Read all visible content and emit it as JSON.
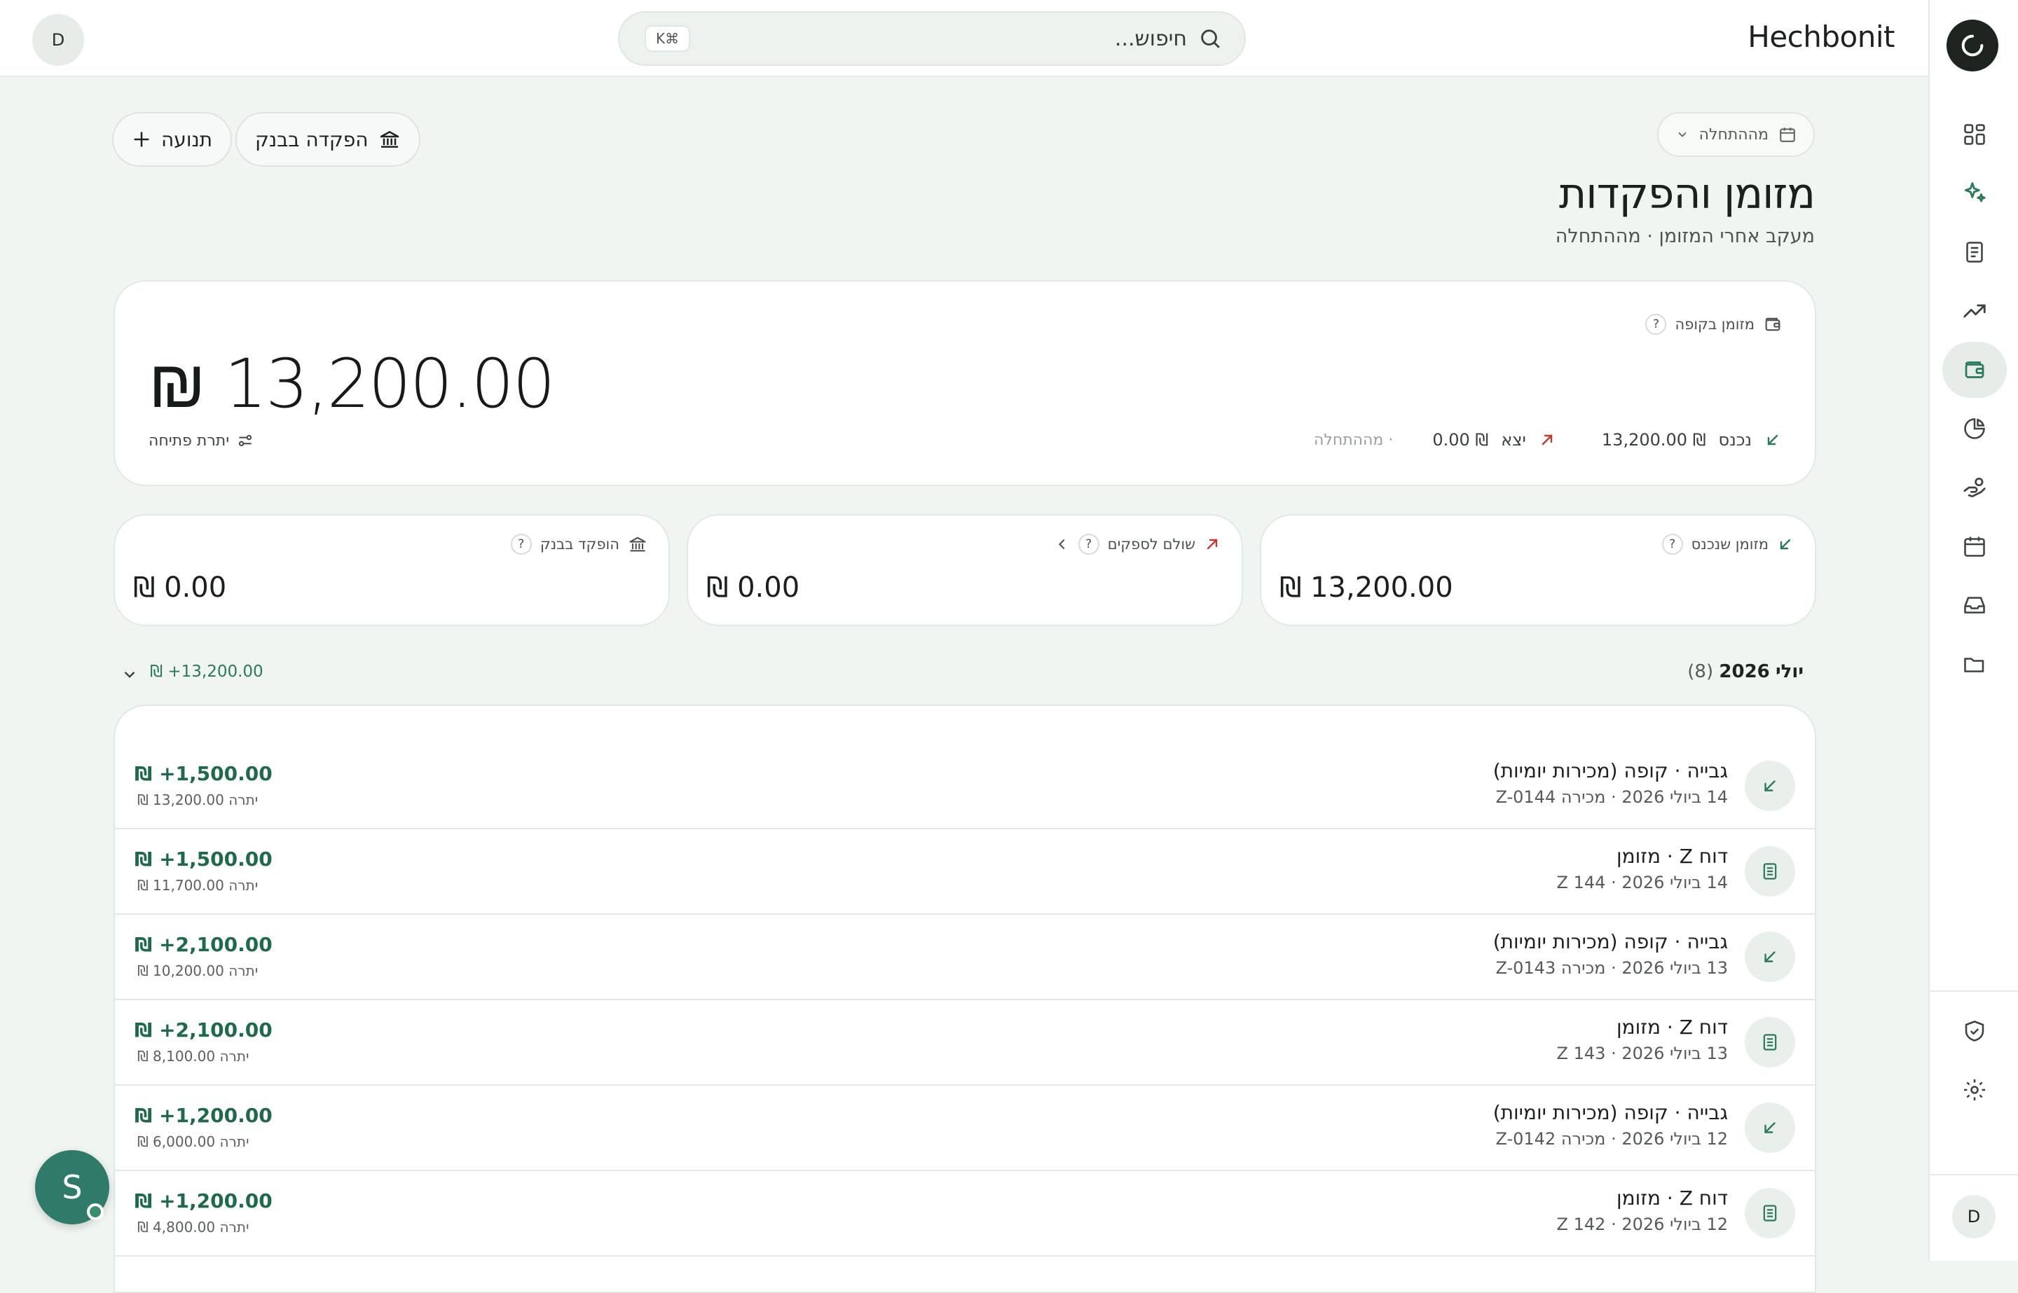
{
  "app": {
    "brand": "Hechbonit",
    "user_initial": "D"
  },
  "search": {
    "placeholder": "חיפוש...",
    "shortcut": "K⌘"
  },
  "header": {
    "title": "מזומן והפקדות",
    "subtitle": "מעקב אחרי המזומן · מההתחלה",
    "date_filter": "מההתחלה",
    "deposit_button": "הפקדה בבנק",
    "transaction_button": "תנועה"
  },
  "cash_card": {
    "label": "מזומן בקופה",
    "help": "?",
    "amount": "₪ 13,200.00",
    "in_label": "נכנס",
    "in_value": "₪ 13,200.00",
    "out_label": "יצא",
    "out_value": "₪ 0.00",
    "period": "· מההתחלה",
    "opening_label": "יתרת פתיחה"
  },
  "kpis": {
    "received": {
      "label": "מזומן שנכנס",
      "help": "?",
      "value": "₪ 13,200.00"
    },
    "paid": {
      "label": "שולם לספקים",
      "help": "?",
      "value": "₪ 0.00"
    },
    "deposited": {
      "label": "הופקד בבנק",
      "help": "?",
      "value": "₪ 0.00"
    }
  },
  "month": {
    "name": "יולי",
    "year": "2026",
    "count": "(8)",
    "total": "₪ +13,200.00"
  },
  "transactions": [
    {
      "title": "גבייה · קופה (מכירות יומיות)",
      "meta": "14 ביולי 2026 · מכירה Z-0144",
      "amount": "₪ +1,500.00",
      "balance": "₪ יתרה 13,200.00",
      "icon": "arrow-down-left-icon"
    },
    {
      "title": "דוח Z · מזומן",
      "meta": "14 ביולי 2026 · Z 144",
      "amount": "₪ +1,500.00",
      "balance": "₪ יתרה 11,700.00",
      "icon": "receipt-icon"
    },
    {
      "title": "גבייה · קופה (מכירות יומיות)",
      "meta": "13 ביולי 2026 · מכירה Z-0143",
      "amount": "₪ +2,100.00",
      "balance": "₪ יתרה 10,200.00",
      "icon": "arrow-down-left-icon"
    },
    {
      "title": "דוח Z · מזומן",
      "meta": "13 ביולי 2026 · Z 143",
      "amount": "₪ +2,100.00",
      "balance": "₪ יתרה 8,100.00",
      "icon": "receipt-icon"
    },
    {
      "title": "גבייה · קופה (מכירות יומיות)",
      "meta": "12 ביולי 2026 · מכירה Z-0142",
      "amount": "₪ +1,200.00",
      "balance": "₪ יתרה 6,000.00",
      "icon": "arrow-down-left-icon"
    },
    {
      "title": "דוח Z · מזומן",
      "meta": "12 ביולי 2026 · Z 142",
      "amount": "₪ +1,200.00",
      "balance": "₪ יתרה 4,800.00",
      "icon": "receipt-icon"
    }
  ],
  "assistant": {
    "initial": "S"
  },
  "colors": {
    "accent": "#2a7a58",
    "outflow": "#c0392b",
    "fab": "#2f7a68",
    "background": "#f1f5f2"
  },
  "nav_icons": [
    "dashboard-icon",
    "sparkle-icon",
    "document-icon",
    "trend-icon",
    "wallet-icon",
    "pie-chart-icon",
    "hand-coins-icon",
    "calendar-icon",
    "inbox-icon",
    "folder-icon",
    "shield-check-icon",
    "settings-icon"
  ]
}
